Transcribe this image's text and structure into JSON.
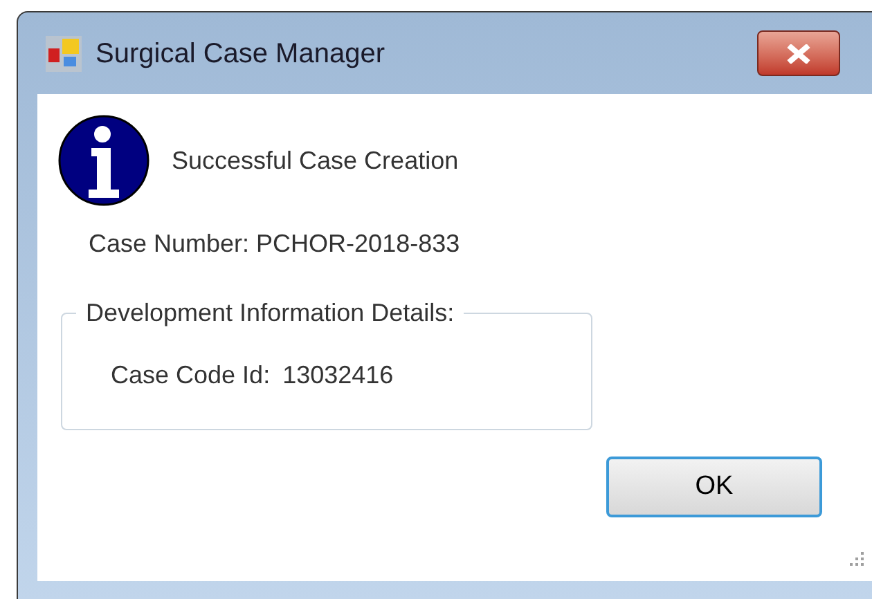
{
  "window": {
    "title": "Surgical Case Manager"
  },
  "message": "Successful Case Creation",
  "case_number": "Case Number: PCHOR-2018-833",
  "group": {
    "legend": "Development Information Details:",
    "case_code_label": "Case Code Id:",
    "case_code_value": "13032416"
  },
  "buttons": [
    {
      "label": "OK",
      "kind": "default"
    }
  ]
}
